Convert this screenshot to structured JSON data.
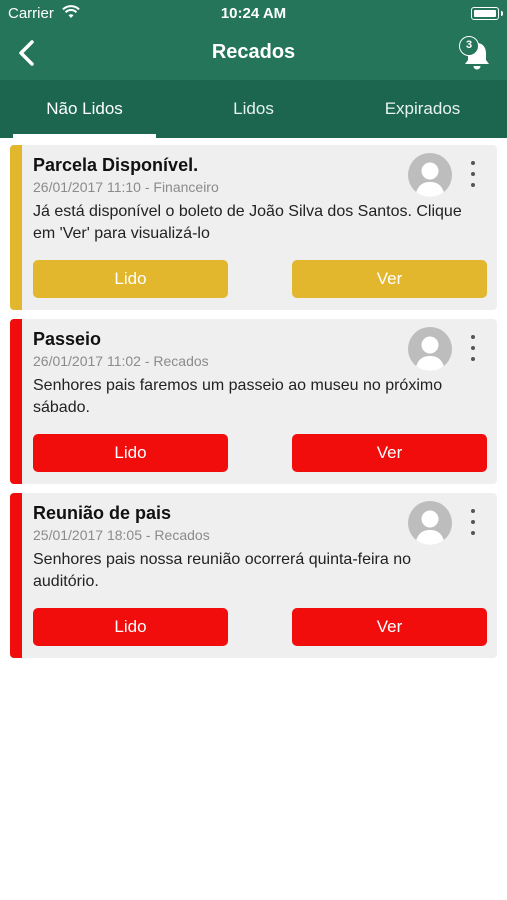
{
  "status_bar": {
    "carrier": "Carrier",
    "time": "10:24 AM"
  },
  "nav": {
    "title": "Recados",
    "notifications_badge": "3"
  },
  "tabs": [
    {
      "label": "Não Lidos",
      "active": true
    },
    {
      "label": "Lidos",
      "active": false
    },
    {
      "label": "Expirados",
      "active": false
    }
  ],
  "colors": {
    "header": "#24755a",
    "tabs": "#1c6650",
    "yellow": "#e2b72d",
    "red": "#f20d0d",
    "card_bg": "#efefef"
  },
  "cards": [
    {
      "title": "Parcela Disponível.",
      "meta": "26/01/2017 11:10 - Financeiro",
      "body": "Já está disponível o boleto de João Silva dos Santos. Clique em 'Ver' para visualizá-lo",
      "accent": "yellow",
      "lido_label": "Lido",
      "ver_label": "Ver"
    },
    {
      "title": "Passeio",
      "meta": "26/01/2017 11:02 - Recados",
      "body": "Senhores pais faremos um passeio ao museu no próximo sábado.",
      "accent": "red",
      "lido_label": "Lido",
      "ver_label": "Ver"
    },
    {
      "title": "Reunião de pais",
      "meta": "25/01/2017 18:05 - Recados",
      "body": "Senhores pais nossa reunião ocorrerá quinta-feira no auditório.",
      "accent": "red",
      "lido_label": "Lido",
      "ver_label": "Ver"
    }
  ]
}
